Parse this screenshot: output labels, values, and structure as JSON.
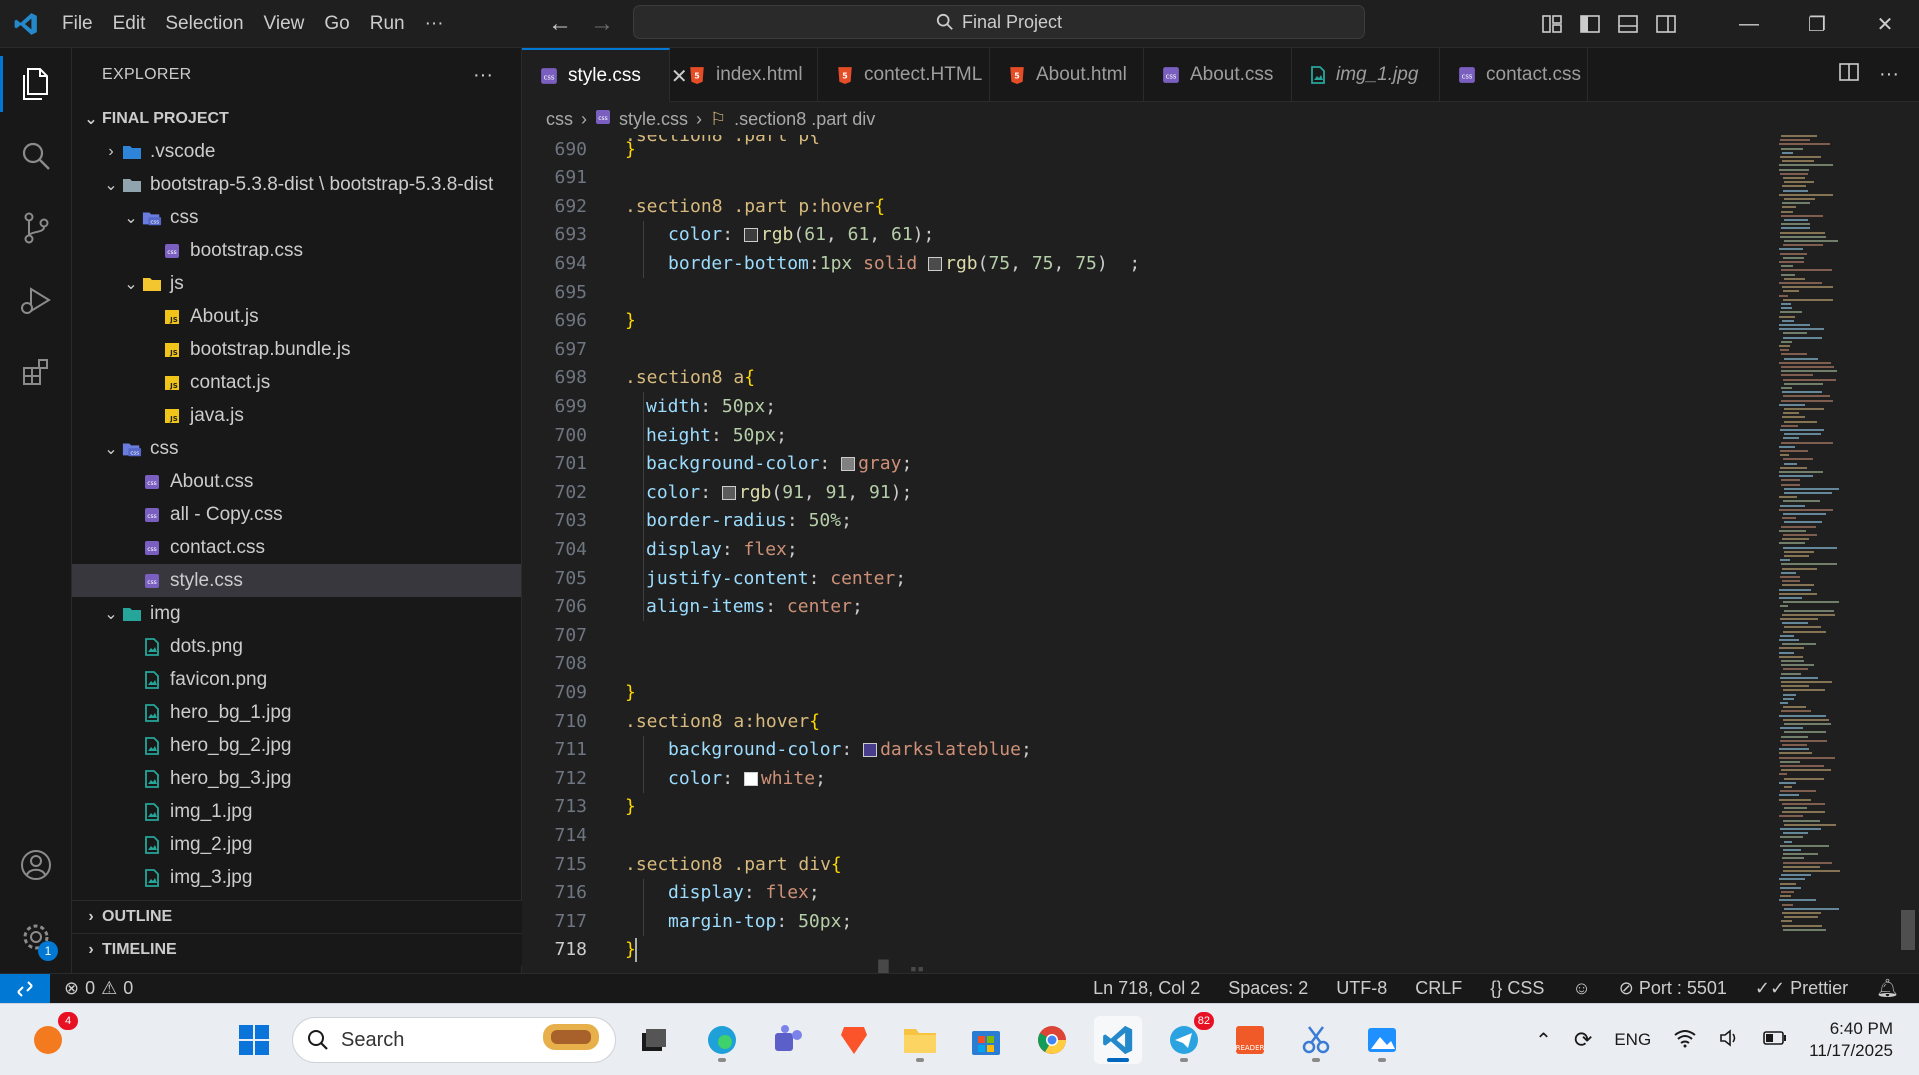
{
  "titlebar": {
    "menu": [
      "File",
      "Edit",
      "Selection",
      "View",
      "Go",
      "Run"
    ],
    "more": "···",
    "search_text": "Final Project"
  },
  "sidebar": {
    "title": "EXPLORER",
    "more": "···",
    "root": "FINAL PROJECT",
    "tree": [
      {
        "label": ".vscode",
        "depth": 1,
        "type": "folder-vscode",
        "expanded": false
      },
      {
        "label": "bootstrap-5.3.8-dist \\ bootstrap-5.3.8-dist",
        "depth": 1,
        "type": "folder",
        "expanded": true
      },
      {
        "label": "css",
        "depth": 2,
        "type": "folder-css",
        "expanded": true
      },
      {
        "label": "bootstrap.css",
        "depth": 3,
        "type": "css"
      },
      {
        "label": "js",
        "depth": 2,
        "type": "folder-js",
        "expanded": true
      },
      {
        "label": "About.js",
        "depth": 3,
        "type": "js"
      },
      {
        "label": "bootstrap.bundle.js",
        "depth": 3,
        "type": "js"
      },
      {
        "label": "contact.js",
        "depth": 3,
        "type": "js"
      },
      {
        "label": "java.js",
        "depth": 3,
        "type": "js"
      },
      {
        "label": "css",
        "depth": 1,
        "type": "folder-css",
        "expanded": true
      },
      {
        "label": "About.css",
        "depth": 2,
        "type": "css"
      },
      {
        "label": "all - Copy.css",
        "depth": 2,
        "type": "css"
      },
      {
        "label": "contact.css",
        "depth": 2,
        "type": "css"
      },
      {
        "label": "style.css",
        "depth": 2,
        "type": "css",
        "selected": true
      },
      {
        "label": "img",
        "depth": 1,
        "type": "folder-img",
        "expanded": true
      },
      {
        "label": "dots.png",
        "depth": 2,
        "type": "img"
      },
      {
        "label": "favicon.png",
        "depth": 2,
        "type": "img"
      },
      {
        "label": "hero_bg_1.jpg",
        "depth": 2,
        "type": "img"
      },
      {
        "label": "hero_bg_2.jpg",
        "depth": 2,
        "type": "img"
      },
      {
        "label": "hero_bg_3.jpg",
        "depth": 2,
        "type": "img"
      },
      {
        "label": "img_1.jpg",
        "depth": 2,
        "type": "img"
      },
      {
        "label": "img_2.jpg",
        "depth": 2,
        "type": "img"
      },
      {
        "label": "img_3.jpg",
        "depth": 2,
        "type": "img"
      }
    ],
    "outline": "OUTLINE",
    "timeline": "TIMELINE"
  },
  "tabs": [
    {
      "label": "style.css",
      "type": "css",
      "active": true
    },
    {
      "label": "index.html",
      "type": "html"
    },
    {
      "label": "contect.HTML",
      "type": "html"
    },
    {
      "label": "About.html",
      "type": "html"
    },
    {
      "label": "About.css",
      "type": "css"
    },
    {
      "label": "img_1.jpg",
      "type": "img",
      "italic": true
    },
    {
      "label": "contact.css",
      "type": "css"
    }
  ],
  "breadcrumb": {
    "folder": "css",
    "file": "style.css",
    "symbol": ".section8 .part div"
  },
  "editor": {
    "partial_top": ".section8 .part p{",
    "lines": [
      {
        "n": "690",
        "tokens": [
          {
            "t": "}",
            "c": "brace"
          }
        ]
      },
      {
        "n": "691",
        "tokens": []
      },
      {
        "n": "692",
        "tokens": [
          {
            "t": ".section8 .part p:hover",
            "c": "sel"
          },
          {
            "t": "{",
            "c": "brace"
          }
        ]
      },
      {
        "n": "693",
        "indent": 2,
        "tokens": [
          {
            "t": "color",
            "c": "prop"
          },
          {
            "t": ": ",
            "c": "punc"
          },
          {
            "sw": "#3d3d3d"
          },
          {
            "t": "rgb",
            "c": "fn"
          },
          {
            "t": "(",
            "c": "punc"
          },
          {
            "t": "61",
            "c": "num"
          },
          {
            "t": ", ",
            "c": "punc"
          },
          {
            "t": "61",
            "c": "num"
          },
          {
            "t": ", ",
            "c": "punc"
          },
          {
            "t": "61",
            "c": "num"
          },
          {
            "t": ");",
            "c": "punc"
          }
        ]
      },
      {
        "n": "694",
        "indent": 2,
        "tokens": [
          {
            "t": "border-bottom",
            "c": "prop"
          },
          {
            "t": ":",
            "c": "punc"
          },
          {
            "t": "1px",
            "c": "num"
          },
          {
            "t": " solid ",
            "c": "val"
          },
          {
            "sw": "#4b4b4b"
          },
          {
            "t": "rgb",
            "c": "fn"
          },
          {
            "t": "(",
            "c": "punc"
          },
          {
            "t": "75",
            "c": "num"
          },
          {
            "t": ", ",
            "c": "punc"
          },
          {
            "t": "75",
            "c": "num"
          },
          {
            "t": ", ",
            "c": "punc"
          },
          {
            "t": "75",
            "c": "num"
          },
          {
            "t": ")  ;",
            "c": "punc"
          }
        ]
      },
      {
        "n": "695",
        "tokens": []
      },
      {
        "n": "696",
        "tokens": [
          {
            "t": "}",
            "c": "brace"
          }
        ]
      },
      {
        "n": "697",
        "tokens": []
      },
      {
        "n": "698",
        "tokens": [
          {
            "t": ".section8 a",
            "c": "sel"
          },
          {
            "t": "{",
            "c": "brace"
          }
        ]
      },
      {
        "n": "699",
        "indent": 1,
        "tokens": [
          {
            "t": "width",
            "c": "prop"
          },
          {
            "t": ": ",
            "c": "punc"
          },
          {
            "t": "50px",
            "c": "num"
          },
          {
            "t": ";",
            "c": "punc"
          }
        ]
      },
      {
        "n": "700",
        "indent": 1,
        "tokens": [
          {
            "t": "height",
            "c": "prop"
          },
          {
            "t": ": ",
            "c": "punc"
          },
          {
            "t": "50px",
            "c": "num"
          },
          {
            "t": ";",
            "c": "punc"
          }
        ]
      },
      {
        "n": "701",
        "indent": 1,
        "tokens": [
          {
            "t": "background-color",
            "c": "prop"
          },
          {
            "t": ": ",
            "c": "punc"
          },
          {
            "sw": "#808080"
          },
          {
            "t": "gray",
            "c": "val"
          },
          {
            "t": ";",
            "c": "punc"
          }
        ]
      },
      {
        "n": "702",
        "indent": 1,
        "tokens": [
          {
            "t": "color",
            "c": "prop"
          },
          {
            "t": ": ",
            "c": "punc"
          },
          {
            "sw": "#5b5b5b"
          },
          {
            "t": "rgb",
            "c": "fn"
          },
          {
            "t": "(",
            "c": "punc"
          },
          {
            "t": "91",
            "c": "num"
          },
          {
            "t": ", ",
            "c": "punc"
          },
          {
            "t": "91",
            "c": "num"
          },
          {
            "t": ", ",
            "c": "punc"
          },
          {
            "t": "91",
            "c": "num"
          },
          {
            "t": ");",
            "c": "punc"
          }
        ]
      },
      {
        "n": "703",
        "indent": 1,
        "tokens": [
          {
            "t": "border-radius",
            "c": "prop"
          },
          {
            "t": ": ",
            "c": "punc"
          },
          {
            "t": "50%",
            "c": "num"
          },
          {
            "t": ";",
            "c": "punc"
          }
        ]
      },
      {
        "n": "704",
        "indent": 1,
        "tokens": [
          {
            "t": "display",
            "c": "prop"
          },
          {
            "t": ": ",
            "c": "punc"
          },
          {
            "t": "flex",
            "c": "val"
          },
          {
            "t": ";",
            "c": "punc"
          }
        ]
      },
      {
        "n": "705",
        "indent": 1,
        "tokens": [
          {
            "t": "justify-content",
            "c": "prop"
          },
          {
            "t": ": ",
            "c": "punc"
          },
          {
            "t": "center",
            "c": "val"
          },
          {
            "t": ";",
            "c": "punc"
          }
        ]
      },
      {
        "n": "706",
        "indent": 1,
        "tokens": [
          {
            "t": "align-items",
            "c": "prop"
          },
          {
            "t": ": ",
            "c": "punc"
          },
          {
            "t": "center",
            "c": "val"
          },
          {
            "t": ";",
            "c": "punc"
          }
        ]
      },
      {
        "n": "707",
        "tokens": []
      },
      {
        "n": "708",
        "tokens": []
      },
      {
        "n": "709",
        "tokens": [
          {
            "t": "}",
            "c": "brace"
          }
        ]
      },
      {
        "n": "710",
        "tokens": [
          {
            "t": ".section8 a:hover",
            "c": "sel"
          },
          {
            "t": "{",
            "c": "brace"
          }
        ]
      },
      {
        "n": "711",
        "indent": 2,
        "tokens": [
          {
            "t": "background-color",
            "c": "prop"
          },
          {
            "t": ": ",
            "c": "punc"
          },
          {
            "sw": "#483d8b"
          },
          {
            "t": "darkslateblue",
            "c": "val"
          },
          {
            "t": ";",
            "c": "punc"
          }
        ]
      },
      {
        "n": "712",
        "indent": 2,
        "tokens": [
          {
            "t": "color",
            "c": "prop"
          },
          {
            "t": ": ",
            "c": "punc"
          },
          {
            "sw": "#ffffff"
          },
          {
            "t": "white",
            "c": "val"
          },
          {
            "t": ";",
            "c": "punc"
          }
        ]
      },
      {
        "n": "713",
        "tokens": [
          {
            "t": "}",
            "c": "brace"
          }
        ]
      },
      {
        "n": "714",
        "tokens": []
      },
      {
        "n": "715",
        "tokens": [
          {
            "t": ".section8 .part div",
            "c": "sel"
          },
          {
            "t": "{",
            "c": "brace"
          }
        ]
      },
      {
        "n": "716",
        "indent": 2,
        "tokens": [
          {
            "t": "display",
            "c": "prop"
          },
          {
            "t": ": ",
            "c": "punc"
          },
          {
            "t": "flex",
            "c": "val"
          },
          {
            "t": ";",
            "c": "punc"
          }
        ]
      },
      {
        "n": "717",
        "indent": 2,
        "tokens": [
          {
            "t": "margin-top",
            "c": "prop"
          },
          {
            "t": ": ",
            "c": "punc"
          },
          {
            "t": "50px",
            "c": "num"
          },
          {
            "t": ";",
            "c": "punc"
          }
        ]
      },
      {
        "n": "718",
        "current": true,
        "tokens": [
          {
            "t": "}",
            "c": "brace"
          }
        ]
      }
    ]
  },
  "statusbar": {
    "errors": "0",
    "warnings": "0",
    "position": "Ln 718, Col 2",
    "spaces": "Spaces: 2",
    "encoding": "UTF-8",
    "eol": "CRLF",
    "language": "CSS",
    "port": "Port : 5501",
    "prettier": "Prettier"
  },
  "activitybar": {
    "settings_badge": "1"
  },
  "watermark": "مستقل",
  "taskbar": {
    "search_text": "Search",
    "notification_badge": "4",
    "telegram_badge": "82",
    "language": "ENG",
    "time": "6:40 PM",
    "date": "11/17/2025"
  },
  "colors": {
    "accent": "#0078d4",
    "editor_bg": "#1f1f1f",
    "sidebar_bg": "#181818"
  }
}
